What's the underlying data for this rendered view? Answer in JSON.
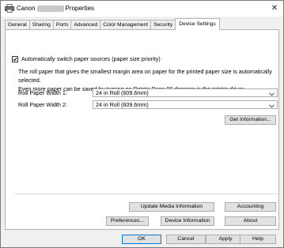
{
  "window": {
    "title_prefix": "Canon",
    "title_suffix": "Properties",
    "close_glyph": "✕"
  },
  "tabs": [
    {
      "label": "General"
    },
    {
      "label": "Sharing"
    },
    {
      "label": "Ports"
    },
    {
      "label": "Advanced"
    },
    {
      "label": "Color Management"
    },
    {
      "label": "Security"
    },
    {
      "label": "Device Settings"
    }
  ],
  "device_settings": {
    "auto_switch": {
      "label": "Automatically switch paper sources (paper size priority)",
      "checked": true
    },
    "description_line1": "The roll paper that gives the smallest margin area on paper for the printed paper size is automatically selected.",
    "description_line2": "Even more paper can be saved by turning on Rotate Page 90 degrees in the printer driver.",
    "roll_paper_width_1": {
      "label": "Roll Paper Width 1:",
      "value": "24 in Roll (609.6mm)"
    },
    "roll_paper_width_2": {
      "label": "Roll Paper Width 2:",
      "value": "24 in Roll (609.6mm)"
    },
    "get_information_label": "Get Information...",
    "update_media_label": "Update Media Information",
    "accounting_label": "Accounting",
    "preferences_label": "Preferences...",
    "device_information_label": "Device Information",
    "about_label": "About"
  },
  "footer": {
    "ok_label": "OK",
    "cancel_label": "Cancel",
    "apply_label": "Apply",
    "help_label": "Help"
  },
  "icons": {
    "printer": "printer-icon",
    "close": "close-icon",
    "chevron": "chevron-down-icon",
    "check": "checkmark-icon"
  },
  "colors": {
    "window_bg": "#f0f0f0",
    "panel_bg": "#ffffff",
    "button_bg": "#e1e1e1",
    "default_button_border": "#0078d7"
  }
}
